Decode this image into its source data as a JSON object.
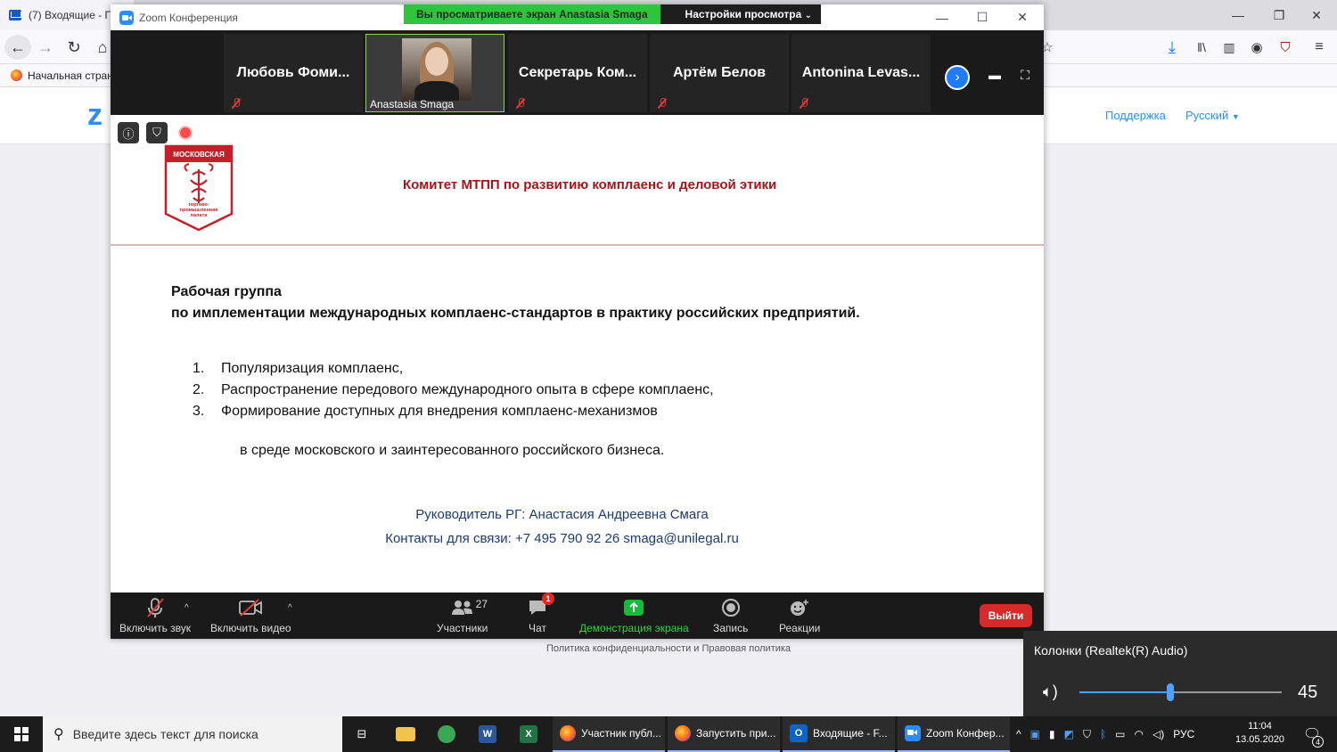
{
  "browser": {
    "tab_title": "(7) Входящие - П",
    "bookmark": "Начальная стран",
    "site_support": "Поддержка",
    "site_language": "Русский",
    "site_logo_fragment": "z",
    "footer_text": "Политика конфиденциальности и Правовая политика"
  },
  "zoom": {
    "window_title": "Zoom Конференция",
    "share_banner": "Вы просматриваете экран Anastasia Smaga",
    "view_settings": "Настройки просмотра",
    "participants_strip": [
      {
        "name": "Любовь Фоми...",
        "muted": true
      },
      {
        "name": "Anastasia Smaga",
        "video": true
      },
      {
        "name": "Секретарь Ком...",
        "muted": true
      },
      {
        "name": "Артём Белов",
        "muted": true
      },
      {
        "name": "Antonina Levas...",
        "muted": true
      }
    ]
  },
  "slide": {
    "logo_text_top": "МОСКОВСКАЯ",
    "logo_text_bottom": [
      "торгово-",
      "промышленная",
      "палата"
    ],
    "header": "Комитет МТПП по развитию комплаенс и деловой этики",
    "wg_title_line1": "Рабочая группа",
    "wg_title_line2": "по имплементации международных комплаенс-стандартов в практику российских предприятий.",
    "goals": [
      {
        "num": "1.",
        "text": "Популяризация комплаенс,"
      },
      {
        "num": "2.",
        "text": "Распространение передового международного опыта в сфере комплаенс,"
      },
      {
        "num": "3.",
        "text": "Формирование доступных для внедрения комплаенс-механизмов"
      }
    ],
    "goal_continuation": "в среде московского и заинтересованного российского бизнеса.",
    "leader": "Руководитель РГ: Анастасия Андреевна Смага",
    "contacts": "Контакты для связи: +7 495 790 92 26 smaga@unilegal.ru"
  },
  "toolbar": {
    "audio": "Включить звук",
    "video": "Включить видео",
    "participants": "Участники",
    "participants_count": "27",
    "chat": "Чат",
    "chat_badge": "1",
    "share": "Демонстрация экрана",
    "record": "Запись",
    "reactions": "Реакции",
    "leave": "Выйти"
  },
  "volume": {
    "device": "Колонки (Realtek(R) Audio)",
    "value": "45",
    "level": 0.45
  },
  "taskbar": {
    "search_placeholder": "Введите здесь текст для поиска",
    "tasks": [
      "Участник публ...",
      "Запустить при...",
      "Входящие - F...",
      "Zoom Конфер..."
    ],
    "language": "РУС",
    "time": "11:04",
    "date": "13.05.2020",
    "notifications": "4"
  },
  "colors": {
    "zoom_blue": "#2d8cff",
    "mtpp_red": "#a8131a",
    "share_green": "#2fc43d",
    "leave_red": "#d52b2b"
  }
}
